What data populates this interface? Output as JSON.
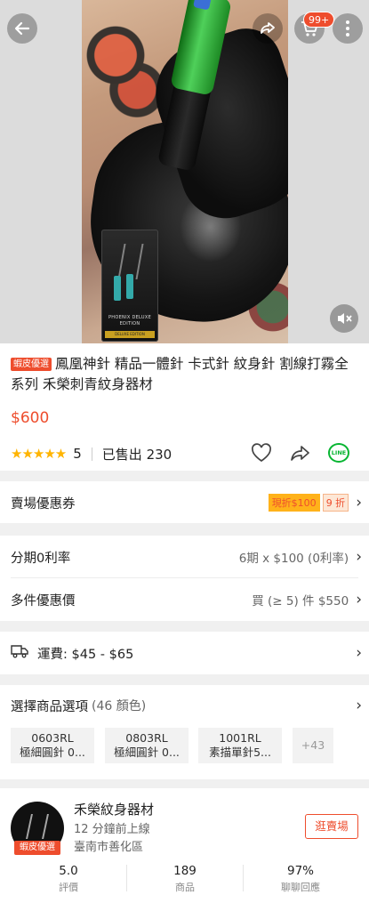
{
  "header": {
    "cart_badge": "99+",
    "icons": {
      "back": "arrow-left-icon",
      "share": "share-icon",
      "cart": "cart-icon",
      "more": "more-vertical-icon",
      "mute": "mute-icon"
    }
  },
  "media": {
    "box_text": "PHOENIX DELUXE EDITION",
    "box_strip": "DELUXE EDITION"
  },
  "product": {
    "mall_tag": "蝦皮優選",
    "title": "鳳凰神針 精品一體針 卡式針 紋身針 割線打霧全系列 禾榮刺青紋身器材",
    "price": "$600",
    "stars": "★★★★★",
    "rating": "5",
    "sold": "已售出 230",
    "line_label": "LINE"
  },
  "vouchers": {
    "label": "賣場優惠券",
    "items": [
      "現折$100",
      "9 折"
    ]
  },
  "installment": {
    "label": "分期0利率",
    "value": "6期 x $100 (0利率)"
  },
  "bulk": {
    "label": "多件優惠價",
    "value": "買 (≥ 5) 件 $550"
  },
  "shipping": {
    "label": "運費: $45 - $65"
  },
  "options": {
    "label": "選擇商品選項",
    "count": "(46 顏色)",
    "items": [
      {
        "code": "0603RL",
        "name": "極細圓針 0..."
      },
      {
        "code": "0803RL",
        "name": "極細圓針 0..."
      },
      {
        "code": "1001RL",
        "name": "素描單針5..."
      }
    ],
    "more": "+43"
  },
  "shop": {
    "name": "禾榮紋身器材",
    "online": "12 分鐘前上線",
    "location": "臺南市善化區",
    "badge": "蝦皮優選",
    "visit": "逛賣場",
    "stats": [
      {
        "value": "5.0",
        "label": "評價"
      },
      {
        "value": "189",
        "label": "商品"
      },
      {
        "value": "97%",
        "label": "聊聊回應"
      }
    ]
  },
  "colors": {
    "accent": "#ee4d2d",
    "star": "#ffb400",
    "line": "#06b531"
  }
}
